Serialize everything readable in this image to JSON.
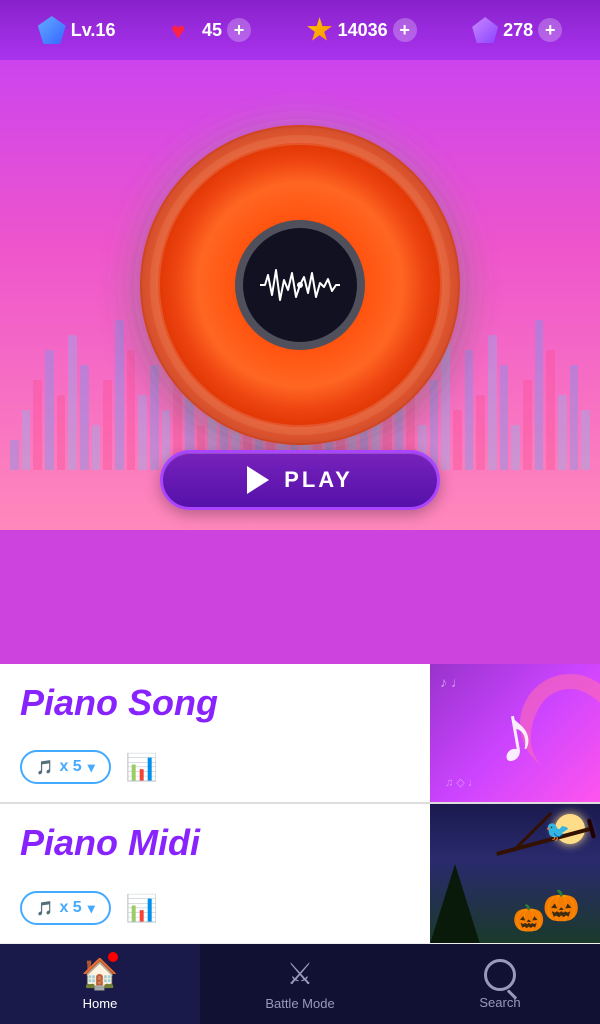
{
  "topBar": {
    "level": "Lv.16",
    "hearts": "45",
    "gold": "14036",
    "gems": "278",
    "plusLabel": "+"
  },
  "vinyl": {
    "waveformLabel": "waveform"
  },
  "playButton": {
    "label": "PLAY"
  },
  "songs": [
    {
      "title": "Piano Song",
      "ticketCount": "x 5",
      "thumbType": "music"
    },
    {
      "title": "Piano Midi",
      "ticketCount": "x 5",
      "thumbType": "halloween"
    }
  ],
  "bottomNav": {
    "items": [
      {
        "id": "home",
        "label": "Home",
        "active": true
      },
      {
        "id": "battle",
        "label": "Battle Mode",
        "active": false
      },
      {
        "id": "search",
        "label": "Search",
        "active": false
      }
    ]
  },
  "eqBars": [
    2,
    4,
    6,
    8,
    5,
    9,
    7,
    3,
    6,
    10,
    8,
    5,
    7,
    4,
    9,
    6,
    3,
    8,
    5,
    10,
    7,
    4,
    6,
    9,
    5,
    8,
    3,
    7,
    10,
    6,
    4,
    9,
    5,
    8,
    7,
    3,
    6,
    10,
    4,
    8,
    5,
    9,
    7,
    3,
    6,
    10,
    8,
    5,
    7,
    4
  ]
}
